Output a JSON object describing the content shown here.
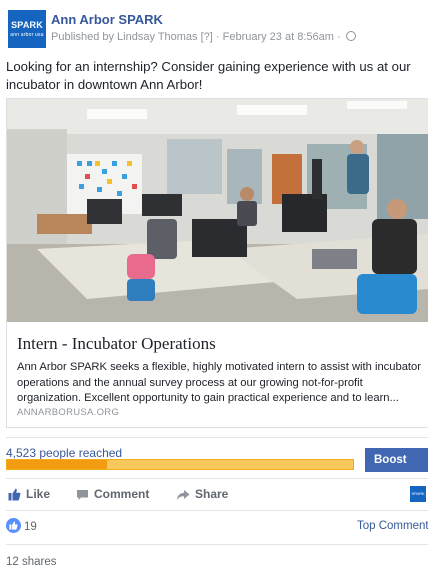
{
  "post": {
    "page_name": "Ann Arbor SPARK",
    "logo_text": "SPARK",
    "logo_subtext": "ann arbor usa",
    "meta_text": "Published by Lindsay Thomas [?] · February 23 at 8:56am ·",
    "globe_icon": "globe-icon",
    "text": "Looking for an internship? Consider gaining experience with us at our incubator in downtown Ann Arbor!"
  },
  "link_card": {
    "title": "Intern - Incubator Operations",
    "description": "Ann Arbor SPARK seeks a flexible, highly motivated intern to assist with incubator operations and the annual survey process at our growing not-for-profit organization. Excellent opportunity to gain practical experience and to learn...",
    "domain": "ANNARBORUSA.ORG"
  },
  "insights": {
    "reach_text": "4,523 people reached",
    "reach_bar_fill": 0.29,
    "boost_label": "Boost Post"
  },
  "actions": {
    "like_label": "Like",
    "comment_label": "Comment",
    "share_label": "Share"
  },
  "reactions": {
    "count": "19",
    "top_comments_label": "Top Comments",
    "shares_text": "12 shares"
  },
  "colors": {
    "link": "#365899",
    "boost_button": "#4267b2",
    "reach_bar": "#f39c12",
    "like_badge": "#5890ff"
  }
}
